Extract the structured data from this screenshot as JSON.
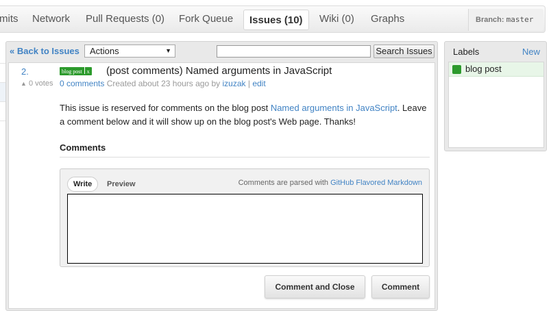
{
  "nav": {
    "tabs": [
      {
        "label": "mits"
      },
      {
        "label": "Network"
      },
      {
        "label": "Pull Requests (0)"
      },
      {
        "label": "Fork Queue"
      },
      {
        "label": "Issues (10)",
        "selected": true
      },
      {
        "label": "Wiki (0)"
      },
      {
        "label": "Graphs"
      }
    ],
    "branch_label": "Branch:",
    "branch_value": "master"
  },
  "toolbar": {
    "back_label": "« Back to Issues",
    "actions_value": "Actions",
    "search_value": "",
    "search_button": "Search Issues"
  },
  "issue": {
    "number": "2.",
    "votes": "0 votes",
    "label_tag": "blog post",
    "label_remove": "x",
    "title": "(post comments) Named arguments in JavaScript",
    "comments_link": "0 comments",
    "created_text": "Created about 23 hours ago by",
    "author": "izuzak",
    "separator": "|",
    "edit_link": "edit",
    "body_before": "This issue is reserved for comments on the blog post ",
    "body_link": "Named arguments in JavaScript",
    "body_after": ". Leave a comment below and it will show up on the blog post's Web page. Thanks!"
  },
  "comments": {
    "heading": "Comments",
    "tab_write": "Write",
    "tab_preview": "Preview",
    "markdown_note": "Comments are parsed with",
    "markdown_link": "GitHub Flavored Markdown",
    "textarea_value": "",
    "close_button": "Comment and Close",
    "comment_button": "Comment"
  },
  "labels": {
    "title": "Labels",
    "new_link": "New",
    "items": [
      {
        "label": "blog post",
        "color": "#2c9a2c"
      }
    ]
  },
  "colors": {
    "link": "#4183c4",
    "label_green": "#2c9a2c"
  }
}
